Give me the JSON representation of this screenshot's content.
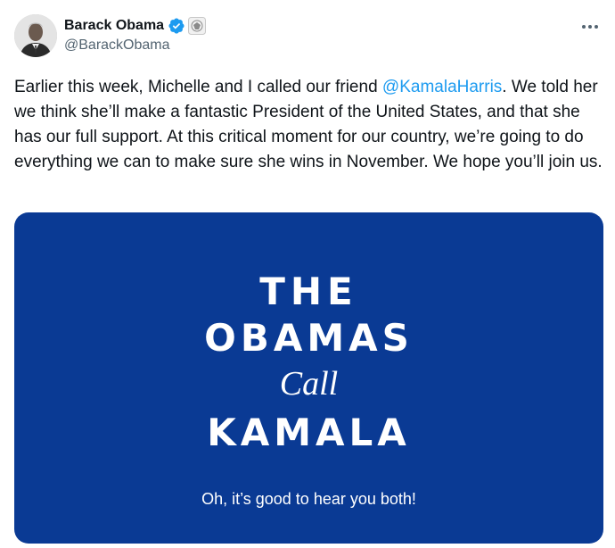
{
  "author": {
    "display_name": "Barack Obama",
    "handle": "@BarackObama",
    "verified_icon": "verified-badge-icon",
    "affiliation_icon": "government-seal-icon"
  },
  "actions": {
    "more_icon": "more-options-icon"
  },
  "tweet": {
    "text_before": "Earlier this week, Michelle and I called our friend ",
    "mention": "@KamalaHarris",
    "text_after": ". We told her we think she’ll make a fantastic President of the United States, and that she has our full support. At this critical moment for our country, we’re going to do everything we can to make sure she wins in November. We hope you’ll join us."
  },
  "media": {
    "line1": "THE",
    "line2": "OBAMAS",
    "line3": "Call",
    "line4": "KAMALA",
    "subtitle": "Oh, it’s good to hear you both!"
  },
  "colors": {
    "mention": "#1d9bf0",
    "card_background": "#0a3a94",
    "verified": "#1d9bf0"
  }
}
